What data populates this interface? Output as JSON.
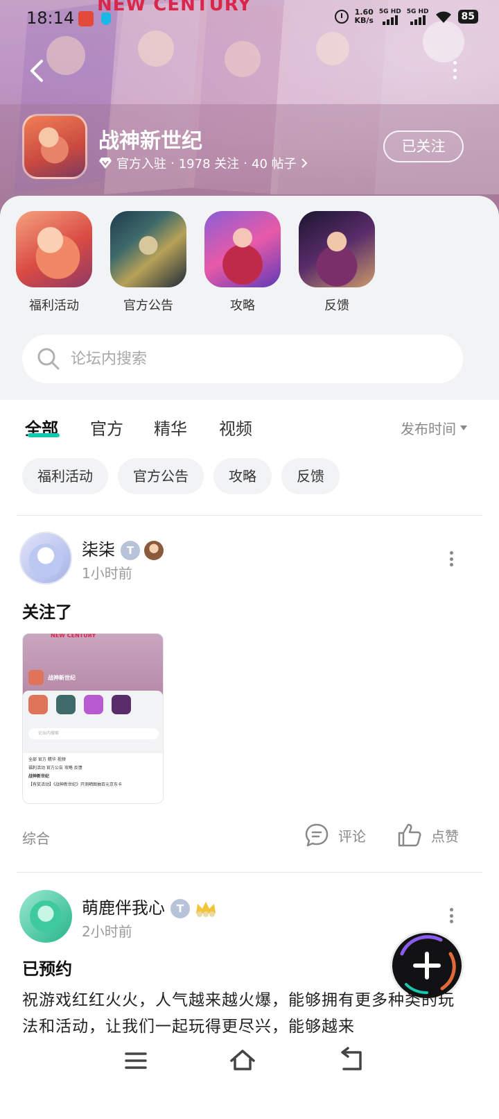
{
  "status_bar": {
    "time": "18:14",
    "net_speed_value": "1.60",
    "net_speed_unit": "KB/s",
    "sim1": "5G HD",
    "sim2": "5G HD",
    "battery": "85"
  },
  "banner": {
    "logo_text": "NEW CENTURY"
  },
  "header": {
    "game_name": "战神新世纪",
    "verified_label": "官方入驻",
    "followers": "1978 关注",
    "posts": "40 帖子",
    "separator": "·",
    "follow_button": "已关注"
  },
  "shortcuts": [
    {
      "label": "福利活动"
    },
    {
      "label": "官方公告"
    },
    {
      "label": "攻略"
    },
    {
      "label": "反馈"
    }
  ],
  "search": {
    "placeholder": "论坛内搜索"
  },
  "tabs": [
    {
      "label": "全部",
      "active": true
    },
    {
      "label": "官方"
    },
    {
      "label": "精华"
    },
    {
      "label": "视频"
    }
  ],
  "sort_label": "发布时间",
  "chips": [
    {
      "label": "福利活动"
    },
    {
      "label": "官方公告"
    },
    {
      "label": "攻略"
    },
    {
      "label": "反馈"
    }
  ],
  "posts": [
    {
      "username": "柒柒",
      "badge": "T",
      "time": "1小时前",
      "title": "关注了",
      "category": "综合",
      "comment_label": "评论",
      "like_label": "点赞",
      "thumb": {
        "logo": "NEW CENTURY",
        "title": "战神新世纪",
        "search": "论坛内搜索",
        "tabs": "全部  官方  精华  视频",
        "chips": "福利活动  官方公告  攻略  反馈",
        "post_user": "战神新世纪",
        "post_line": "【有奖活动】《战神新世纪》开测晒图抽百元京东卡"
      }
    },
    {
      "username": "萌鹿伴我心",
      "badge": "T",
      "time": "2小时前",
      "title": "已预约",
      "body": "祝游戏红红火火，人气越来越火爆，能够拥有更多种类的玩法和活动，让我们一起玩得更尽兴，能够越来"
    }
  ],
  "colors": {
    "accent": "#16c7b0",
    "banner": "#b68aa8",
    "panel": "#f2f3f5"
  }
}
